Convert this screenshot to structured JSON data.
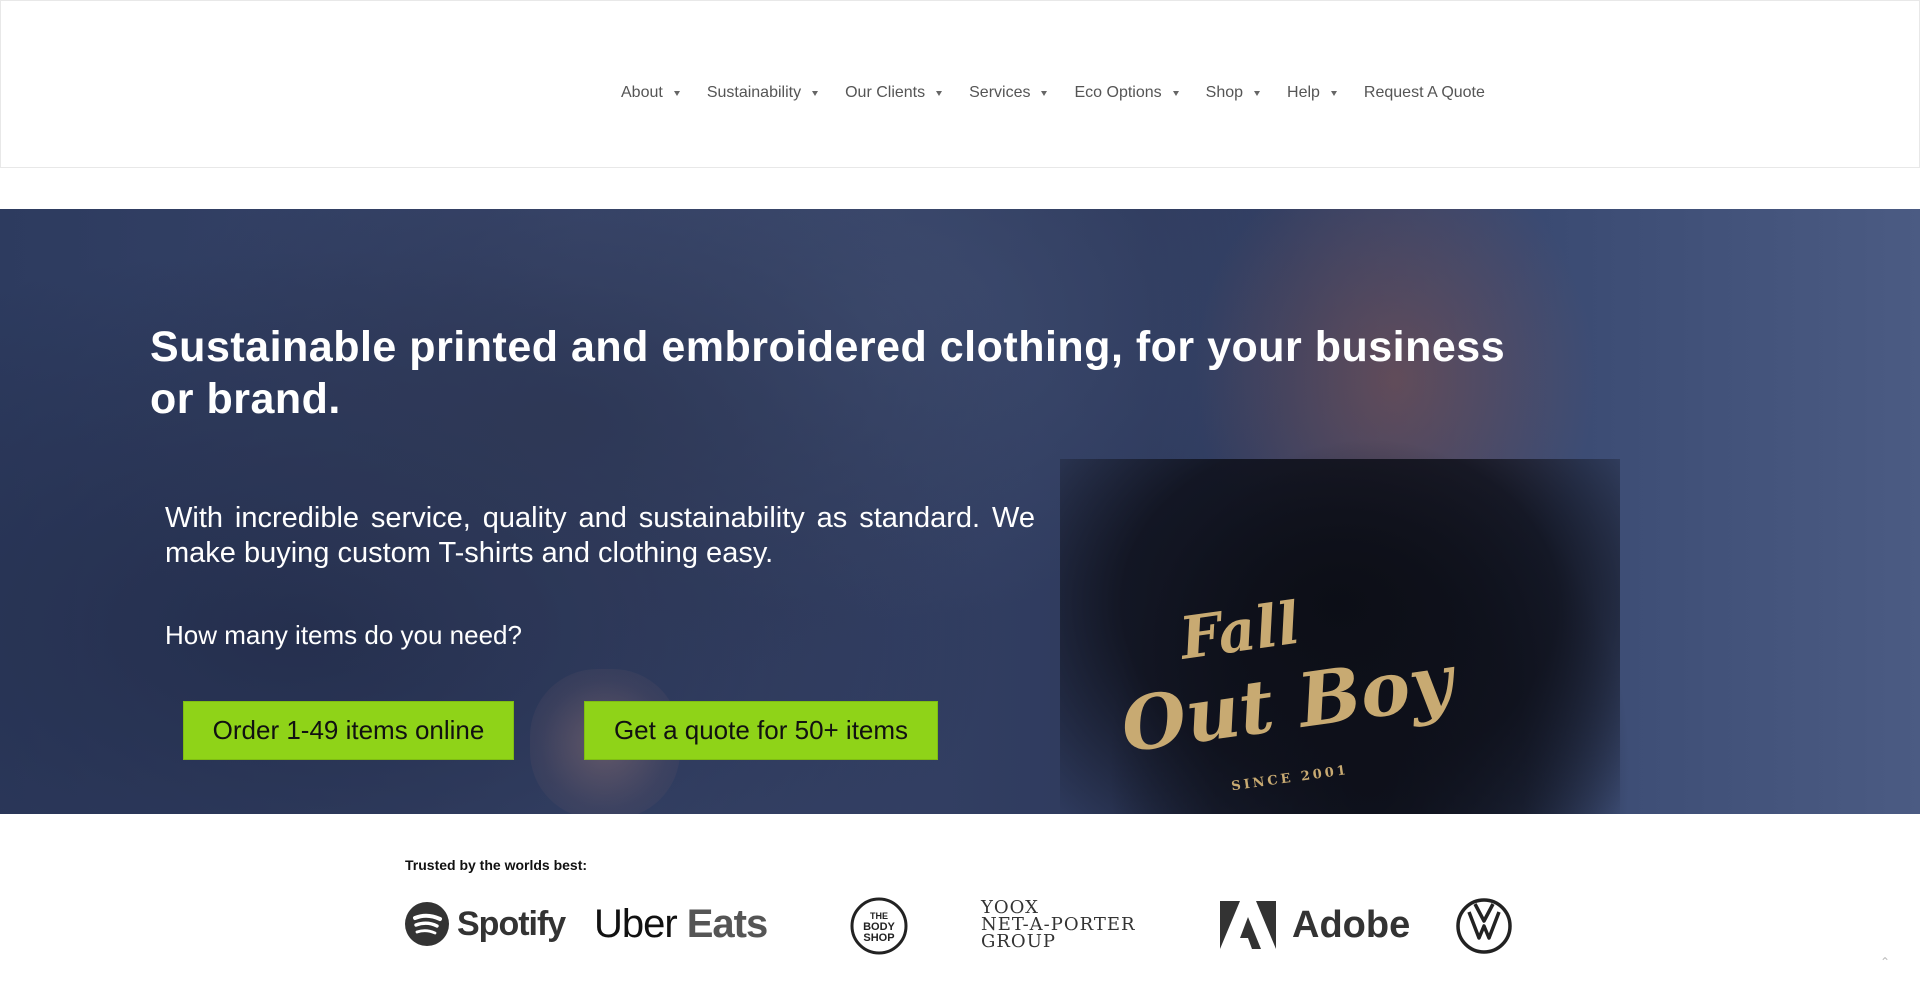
{
  "nav": {
    "items": [
      {
        "label": "About",
        "has_dropdown": true
      },
      {
        "label": "Sustainability",
        "has_dropdown": true
      },
      {
        "label": "Our Clients",
        "has_dropdown": true
      },
      {
        "label": "Services",
        "has_dropdown": true
      },
      {
        "label": "Eco Options",
        "has_dropdown": true
      },
      {
        "label": "Shop",
        "has_dropdown": true
      },
      {
        "label": "Help",
        "has_dropdown": true
      },
      {
        "label": "Request A Quote",
        "has_dropdown": false
      }
    ]
  },
  "hero": {
    "title": "Sustainable printed and embroidered clothing, for your business or brand.",
    "lead": "With incredible service, quality and sustainability as standard. We make buying custom T-shirts and clothing easy.",
    "question": "How many items do you need?",
    "buttons": {
      "order": "Order 1-49 items online",
      "quote": "Get a quote for 50+ items"
    },
    "shirt_text": {
      "line1": "Fall",
      "line2": "Out Boy",
      "line3": "SINCE 2001"
    },
    "accent_color": "#8fd318"
  },
  "trusted": {
    "heading": "Trusted by the worlds best:",
    "logos": {
      "spotify": "Spotify",
      "uber_eats_1": "Uber",
      "uber_eats_2": "Eats",
      "body_shop_1": "THE",
      "body_shop_2": "BODY",
      "body_shop_3": "SHOP",
      "yoox_1": "YOOX",
      "yoox_2": "NET-A-PORTER",
      "yoox_3": "GROUP",
      "adobe": "Adobe"
    }
  }
}
